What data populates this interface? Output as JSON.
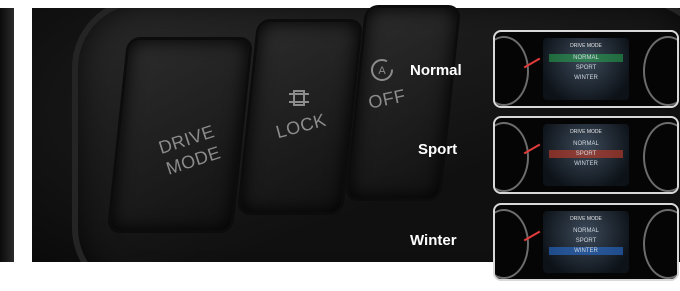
{
  "buttons": {
    "drive_mode": "DRIVE\nMODE",
    "lock": "LOCK",
    "auto_off": "OFF"
  },
  "modes": [
    {
      "label": "Normal",
      "screen_title": "DRIVE MODE",
      "options": [
        "NORMAL",
        "SPORT",
        "WINTER"
      ],
      "selected": "NORMAL",
      "highlight": "#28aa50"
    },
    {
      "label": "Sport",
      "screen_title": "DRIVE MODE",
      "options": [
        "NORMAL",
        "SPORT",
        "WINTER"
      ],
      "selected": "SPORT",
      "highlight": "#c83c28"
    },
    {
      "label": "Winter",
      "screen_title": "DRIVE MODE",
      "options": [
        "NORMAL",
        "SPORT",
        "WINTER"
      ],
      "selected": "WINTER",
      "highlight": "#286ed2"
    }
  ]
}
